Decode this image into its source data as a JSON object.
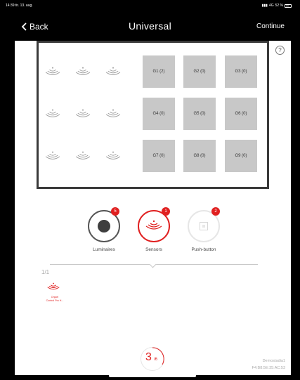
{
  "status_bar": {
    "time": "14:39 tir. 13. aug.",
    "network": "4G",
    "battery": "52 %"
  },
  "nav": {
    "back_label": "Back",
    "title": "Universal",
    "continue_label": "Continue"
  },
  "help": {
    "label": "?"
  },
  "room": {
    "groups": [
      {
        "label": "G1 (2)"
      },
      {
        "label": "G2 (0)"
      },
      {
        "label": "G3 (0)"
      },
      {
        "label": "G4 (0)"
      },
      {
        "label": "G5 (0)"
      },
      {
        "label": "G6 (0)"
      },
      {
        "label": "G7 (0)"
      },
      {
        "label": "G8 (0)"
      },
      {
        "label": "G9 (0)"
      }
    ]
  },
  "categories": [
    {
      "label": "Luminaires",
      "count": "5",
      "icon": "luminaire-icon"
    },
    {
      "label": "Sensors",
      "count": "1",
      "icon": "sensor-icon",
      "active": true
    },
    {
      "label": "Push-button",
      "count": "2",
      "icon": "push-button-icon"
    }
  ],
  "list": {
    "page": "1/1",
    "devices": [
      {
        "line1": "Onjoel",
        "line2": "Control Pro H...",
        "icon": "sensor-icon"
      }
    ]
  },
  "progress": {
    "current": "3",
    "total": "/6"
  },
  "device_info": {
    "name": "Demostadia1",
    "mac": "F4:B8:5E:35:AC:53"
  },
  "colors": {
    "accent": "#e02020",
    "group_cell": "#c8c8c8",
    "frame": "#3a3a3a"
  }
}
